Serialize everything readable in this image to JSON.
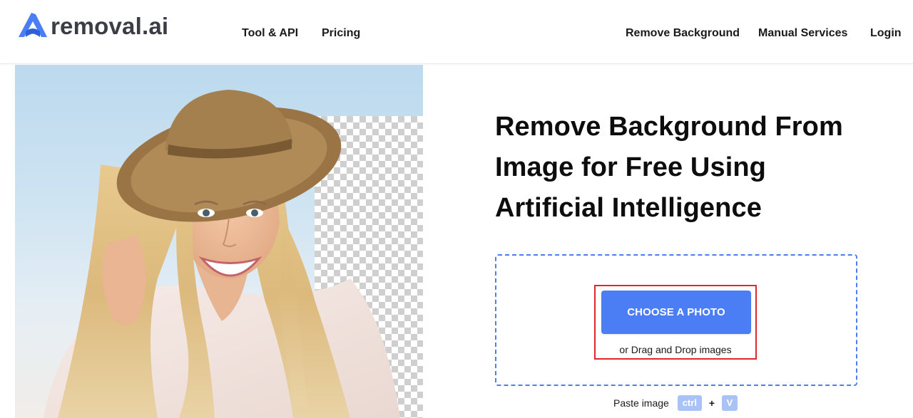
{
  "brand": {
    "name": "removal.ai",
    "logo_icon": "removal-ai-logo-icon",
    "accent_color": "#4b7ef5"
  },
  "nav": {
    "left": [
      {
        "label": "Tool & API"
      },
      {
        "label": "Pricing"
      }
    ],
    "right": [
      {
        "label": "Remove Background"
      },
      {
        "label": "Manual Services"
      },
      {
        "label": "Login"
      }
    ]
  },
  "hero": {
    "headline": "Remove Background From Image for Free Using Artificial Intelligence",
    "image": "woman-in-hat-background-removal-demo"
  },
  "upload": {
    "button_label": "CHOOSE A PHOTO",
    "drag_text": "or Drag and Drop images",
    "highlight_color": "#e2262e",
    "paste_label": "Paste image",
    "key_ctrl": "ctrl",
    "plus": "+",
    "key_v": "V"
  }
}
